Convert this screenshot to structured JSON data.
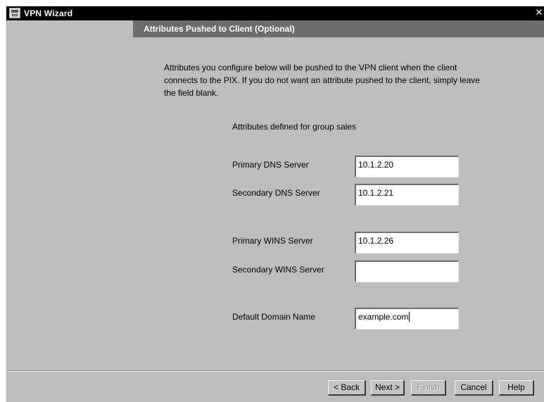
{
  "window": {
    "title": "VPN Wizard",
    "close_glyph": "✕",
    "icon": "vpn-wizard-app-icon"
  },
  "section": {
    "title": "Attributes Pushed to Client (Optional)"
  },
  "intro": {
    "line1": "Attributes you configure below will be pushed to the VPN client when the client",
    "line2": "connects to the PIX.  If you do not want an attribute pushed to the client, simply leave",
    "line3": "the field blank."
  },
  "group_label": "Attributes defined for group sales",
  "fields": {
    "primary_dns": {
      "label": "Primary DNS Server",
      "value": "10.1.2.20"
    },
    "secondary_dns": {
      "label": "Secondary DNS Server",
      "value": "10.1.2.21"
    },
    "primary_wins": {
      "label": "Primary WINS Server",
      "value": "10.1.2.26"
    },
    "secondary_wins": {
      "label": "Secondary WINS Server",
      "value": ""
    },
    "domain": {
      "label": "Default Domain Name",
      "value": "example.com"
    }
  },
  "buttons": {
    "back": "< Back",
    "next": "Next >",
    "finish": "Finish",
    "cancel": "Cancel",
    "help": "Help"
  },
  "colors": {
    "window_bg": "#bdbdbd",
    "titlebar_bg": "#000000",
    "header_bg": "#6c6c6c"
  }
}
